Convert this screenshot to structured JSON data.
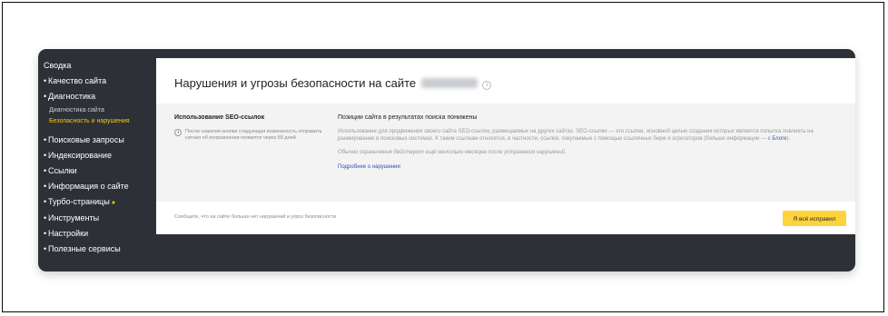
{
  "sidebar": {
    "summary": "Сводка",
    "items_top": [
      {
        "label": "Качество сайта"
      },
      {
        "label": "Диагностика"
      }
    ],
    "sub_items": [
      {
        "label": "Диагностика сайта"
      },
      {
        "label": "Безопасность и нарушения",
        "active": true
      }
    ],
    "items_bottom": [
      {
        "label": "Поисковые запросы"
      },
      {
        "label": "Индексирование"
      },
      {
        "label": "Ссылки"
      },
      {
        "label": "Информация о сайте"
      },
      {
        "label": "Турбо-страницы"
      },
      {
        "label": "Инструменты"
      },
      {
        "label": "Настройки"
      },
      {
        "label": "Полезные сервисы"
      }
    ]
  },
  "main": {
    "title": "Нарушения и угрозы безопасности на сайте",
    "issue": {
      "title": "Использование SEO-ссылок",
      "note": "После нажатия кнопки следующая возможность отправить сигнал об исправлении появится через 89 дней"
    },
    "detail": {
      "title": "Позиции сайта в результатах поиска понижены",
      "text": "Использование для продвижения своего сайта SEO-ссылок, размещаемых на других сайтах. SEO-ссылки — это ссылки, основной целью создания которых является попытка повлиять на ранжирование в поисковых системах. К таким ссылкам относятся, в частности, ссылки, покупаемые с помощью ссылочных бирж и агрегаторов (больше информации — в",
      "text_link": "Блоге",
      "text_end": ").",
      "italic": "Обычно ограничения действуют ещё несколько месяцев после устранения нарушений.",
      "more_link": "Подробнее о нарушении"
    },
    "footer_text": "Сообщите, что на сайте больше нет нарушений и угроз безопасности",
    "fix_button": "Я всё исправил"
  },
  "colors": {
    "sidebar_bg": "#2d3137",
    "accent_yellow": "#ffd43b",
    "active_nav": "#f5c518",
    "link": "#2c52b8"
  }
}
